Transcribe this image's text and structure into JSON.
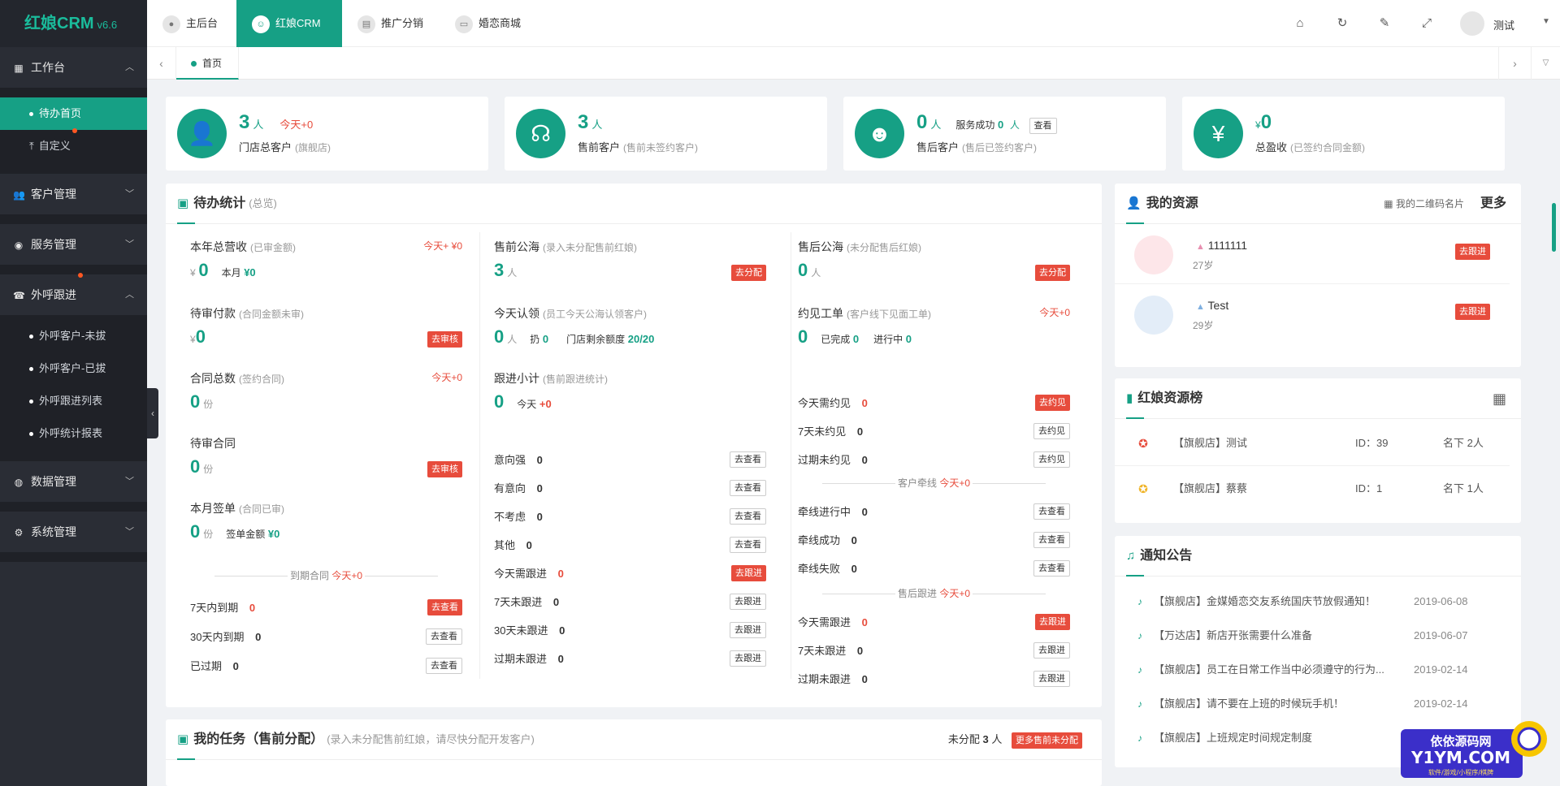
{
  "app": {
    "name": "红娘CRM",
    "version": "v6.6"
  },
  "sidebar": {
    "groups": [
      {
        "label": "工作台",
        "icon": "dashboard-icon",
        "open": true,
        "items": [
          {
            "label": "待办首页",
            "active": true
          },
          {
            "label": "自定义",
            "badge_dot": true
          }
        ]
      },
      {
        "label": "客户管理",
        "icon": "users-icon"
      },
      {
        "label": "服务管理",
        "icon": "service-icon"
      },
      {
        "label": "外呼跟进",
        "icon": "phone-icon",
        "open": true,
        "badge_dot": true,
        "items": [
          {
            "label": "外呼客户-未拔"
          },
          {
            "label": "外呼客户-已拔"
          },
          {
            "label": "外呼跟进列表"
          },
          {
            "label": "外呼统计报表"
          }
        ]
      },
      {
        "label": "数据管理",
        "icon": "data-icon"
      },
      {
        "label": "系统管理",
        "icon": "settings-icon"
      }
    ]
  },
  "topnav": {
    "tabs": [
      {
        "label": "主后台",
        "icon": "user-icon"
      },
      {
        "label": "红娘CRM",
        "icon": "crm-icon",
        "active": true
      },
      {
        "label": "推广分销",
        "icon": "chart-icon"
      },
      {
        "label": "婚恋商城",
        "icon": "shop-icon"
      }
    ],
    "tools": [
      "home-icon",
      "refresh-icon",
      "clear-icon",
      "fullscreen-icon"
    ],
    "user": "测试"
  },
  "tabstrip": {
    "home": "首页"
  },
  "stats": [
    {
      "value": "3",
      "unit": "人",
      "extra": "今天+0",
      "label": "门店总客户",
      "note": "(旗舰店)"
    },
    {
      "value": "3",
      "unit": "人",
      "label": "售前客户",
      "note": "(售前未签约客户)"
    },
    {
      "value": "0",
      "unit": "人",
      "extra_label": "服务成功",
      "extra_value": "0",
      "extra_unit": "人",
      "button": "查看",
      "label": "售后客户",
      "note": "(售后已签约客户)"
    },
    {
      "prefix": "¥",
      "value": "0",
      "label": "总盈收",
      "note": "(已签约合同金额)"
    }
  ],
  "todo": {
    "title": "待办统计",
    "subtitle": "(总览)",
    "col1": {
      "annual": {
        "title": "本年总营收",
        "note": "(已审金额)",
        "today": "今天+ ¥0",
        "prefix": "¥",
        "value": "0",
        "month_label": "本月",
        "month_value": "¥0"
      },
      "pending_pay": {
        "title": "待审付款",
        "note": "(合同金额未审)",
        "prefix": "¥",
        "value": "0",
        "button": "去审核"
      },
      "contracts": {
        "title": "合同总数",
        "note": "(签约合同)",
        "today": "今天+0",
        "value": "0",
        "unit": "份"
      },
      "pending_contract": {
        "title": "待审合同",
        "value": "0",
        "unit": "份",
        "button": "去审核"
      },
      "month_sign": {
        "title": "本月签单",
        "note": "(合同已审)",
        "value": "0",
        "unit": "份",
        "amount_label": "签单金额",
        "amount_value": "¥0"
      },
      "expire_sep": {
        "label": "到期合同",
        "today": "今天+0"
      },
      "expire": [
        {
          "label": "7天内到期",
          "value": "0",
          "button": "去查看",
          "red": true
        },
        {
          "label": "30天内到期",
          "value": "0",
          "button": "去查看"
        },
        {
          "label": "已过期",
          "value": "0",
          "button": "去查看"
        }
      ]
    },
    "col2": {
      "pre_pool": {
        "title": "售前公海",
        "note": "(录入未分配售前红娘)",
        "value": "3",
        "unit": "人",
        "button": "去分配"
      },
      "claim": {
        "title": "今天认领",
        "note": "(员工今天公海认领客户)",
        "value": "0",
        "unit": "人",
        "reset_label": "扔",
        "reset_value": "0",
        "quota_label": "门店剩余额度",
        "quota_value": "20/20"
      },
      "follow": {
        "title": "跟进小计",
        "note": "(售前跟进统计)",
        "value": "0",
        "today_label": "今天",
        "today_value": "+0"
      },
      "list": [
        {
          "label": "意向强",
          "value": "0",
          "button": "去查看"
        },
        {
          "label": "有意向",
          "value": "0",
          "button": "去查看"
        },
        {
          "label": "不考虑",
          "value": "0",
          "button": "去查看"
        },
        {
          "label": "其他",
          "value": "0",
          "button": "去查看"
        },
        {
          "label": "今天需跟进",
          "value": "0",
          "button": "去跟进",
          "red": true
        },
        {
          "label": "7天未跟进",
          "value": "0",
          "button": "去跟进"
        },
        {
          "label": "30天未跟进",
          "value": "0",
          "button": "去跟进"
        },
        {
          "label": "过期未跟进",
          "value": "0",
          "button": "去跟进"
        }
      ]
    },
    "col3": {
      "after_pool": {
        "title": "售后公海",
        "note": "(未分配售后红娘)",
        "value": "0",
        "unit": "人",
        "button": "去分配"
      },
      "meet": {
        "title": "约见工单",
        "note": "(客户线下见面工单)",
        "today": "今天+0",
        "value": "0",
        "done_label": "已完成",
        "done_value": "0",
        "doing_label": "进行中",
        "doing_value": "0"
      },
      "meet_list": [
        {
          "label": "今天需约见",
          "value": "0",
          "button": "去约见",
          "red": true
        },
        {
          "label": "7天未约见",
          "value": "0",
          "button": "去约见"
        },
        {
          "label": "过期未约见",
          "value": "0",
          "button": "去约见"
        }
      ],
      "match_sep": {
        "label": "客户牵线",
        "today": "今天+0"
      },
      "match_list": [
        {
          "label": "牵线进行中",
          "value": "0",
          "button": "去查看"
        },
        {
          "label": "牵线成功",
          "value": "0",
          "button": "去查看"
        },
        {
          "label": "牵线失败",
          "value": "0",
          "button": "去查看"
        }
      ],
      "after_sep": {
        "label": "售后跟进",
        "today": "今天+0"
      },
      "after_list": [
        {
          "label": "今天需跟进",
          "value": "0",
          "button": "去跟进",
          "red": true
        },
        {
          "label": "7天未跟进",
          "value": "0",
          "button": "去跟进"
        },
        {
          "label": "过期未跟进",
          "value": "0",
          "button": "去跟进"
        }
      ]
    }
  },
  "tasks": {
    "title": "我的任务（售前分配）",
    "subtitle": "(录入未分配售前红娘，请尽快分配开发客户)",
    "unassigned_label": "未分配",
    "unassigned_value": "3",
    "unassigned_unit": "人",
    "button": "更多售前未分配"
  },
  "resources": {
    "title": "我的资源",
    "qr_label": "我的二维码名片",
    "more": "更多",
    "items": [
      {
        "name": "1111111",
        "age": "27岁",
        "button": "去跟进",
        "gender": "female"
      },
      {
        "name": "Test",
        "age": "29岁",
        "button": "去跟进",
        "gender": "male"
      }
    ]
  },
  "ranking": {
    "title": "红娘资源榜",
    "items": [
      {
        "store": "【旗舰店】测试",
        "id_label": "ID：39",
        "count": "名下 2人",
        "medal": "red"
      },
      {
        "store": "【旗舰店】蔡蔡",
        "id_label": "ID：1",
        "count": "名下 1人",
        "medal": "gold"
      }
    ]
  },
  "notices": {
    "title": "通知公告",
    "items": [
      {
        "text": "【旗舰店】金媒婚恋交友系统国庆节放假通知！",
        "date": "2019-06-08"
      },
      {
        "text": "【万达店】新店开张需要什么准备",
        "date": "2019-06-07"
      },
      {
        "text": "【旗舰店】员工在日常工作当中必须遵守的行为...",
        "date": "2019-02-14"
      },
      {
        "text": "【旗舰店】请不要在上班的时候玩手机！",
        "date": "2019-02-14"
      },
      {
        "text": "【旗舰店】上班规定时间规定制度",
        "date": ""
      }
    ]
  },
  "watermark": {
    "line1": "依依源码网",
    "line2": "Y1YM.COM",
    "line3": "软件/游戏/小程序/棋牌"
  },
  "colors": {
    "accent": "#16a085",
    "danger": "#e74c3c",
    "sidebar": "#2a2d35"
  }
}
